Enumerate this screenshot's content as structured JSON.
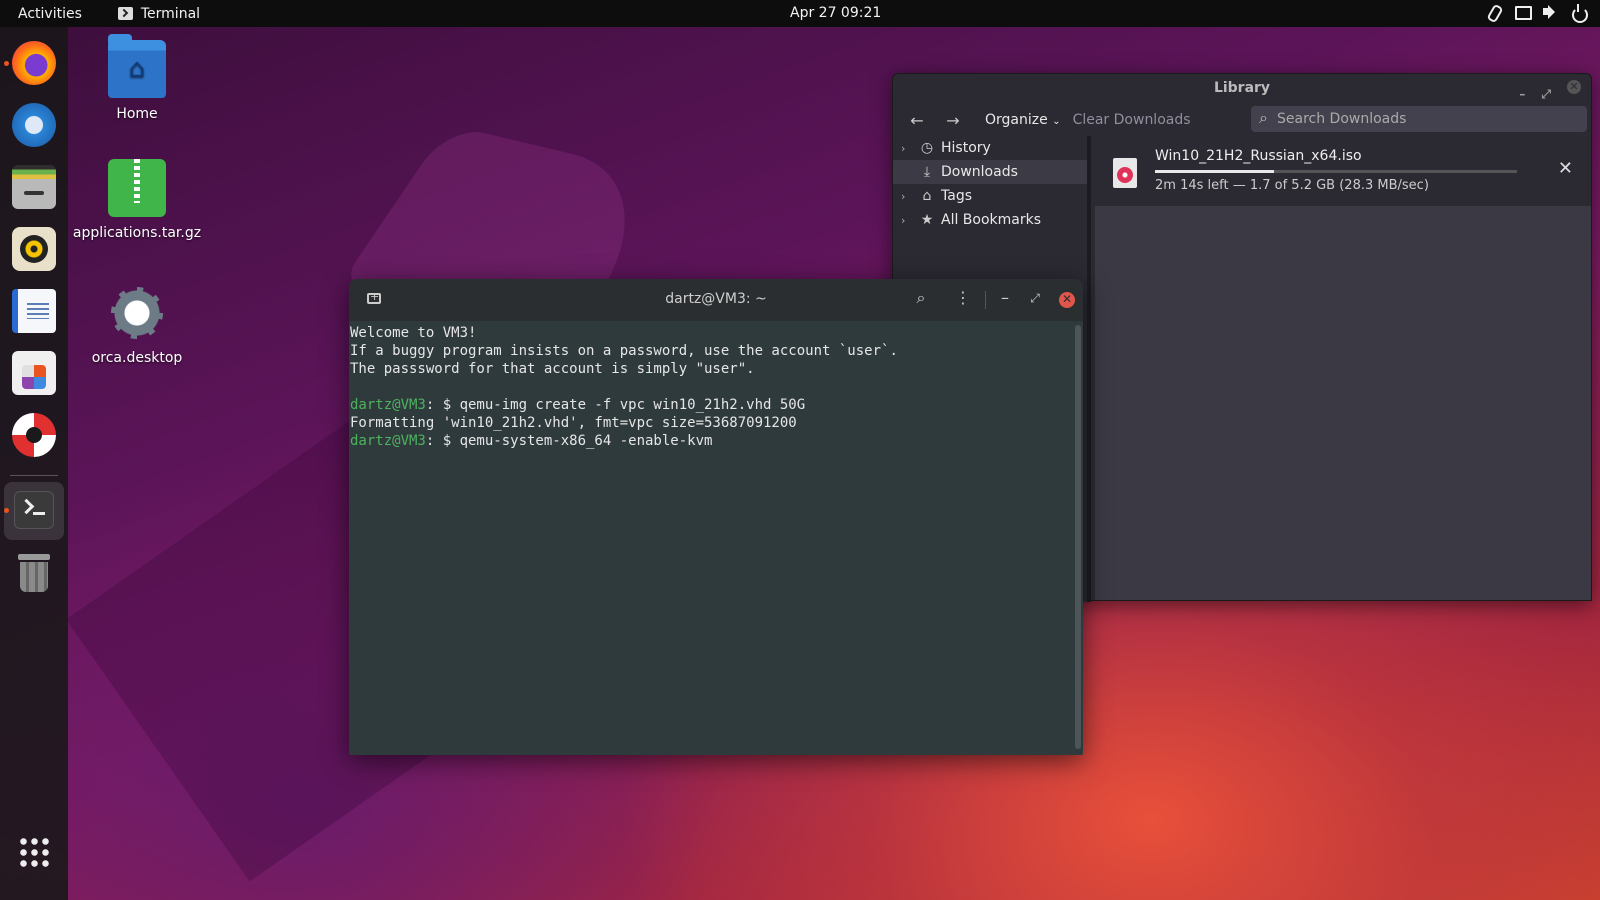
{
  "topbar": {
    "activities": "Activities",
    "app_name": "Terminal",
    "clock": "Apr 27  09:21",
    "tray": [
      "paperclip-icon",
      "display-icon",
      "volume-icon",
      "power-icon"
    ]
  },
  "dock": {
    "items": [
      "firefox",
      "thunderbird",
      "files",
      "rhythmbox",
      "libreoffice-writer",
      "ubuntu-software",
      "help",
      "terminal",
      "trash"
    ],
    "show_apps": "show-applications-icon"
  },
  "desktop": {
    "icons": [
      {
        "label": "Home"
      },
      {
        "label": "applications.tar.gz"
      },
      {
        "label": "orca.desktop"
      }
    ]
  },
  "library": {
    "title": "Library",
    "toolbar": {
      "back": "←",
      "forward": "→",
      "organize": "Organize",
      "clear": "Clear Downloads",
      "search_placeholder": "Search Downloads"
    },
    "sidebar": [
      {
        "label": "History",
        "icon": "clock-icon",
        "expandable": true
      },
      {
        "label": "Downloads",
        "icon": "download-icon",
        "expandable": false,
        "selected": true
      },
      {
        "label": "Tags",
        "icon": "tag-icon",
        "expandable": true
      },
      {
        "label": "All Bookmarks",
        "icon": "star-icon",
        "expandable": true
      }
    ],
    "download": {
      "filename": "Win10_21H2_Russian_x64.iso",
      "status": "2m 14s left — 1.7 of 5.2 GB (28.3 MB/sec)",
      "progress_percent": 33
    }
  },
  "terminal": {
    "title": "dartz@VM3: ~",
    "lines": [
      {
        "text": "Welcome to VM3!"
      },
      {
        "text": "If a buggy program insists on a password, use the account `user`."
      },
      {
        "text": "The passsword for that account is simply \"user\"."
      },
      {
        "text": ""
      },
      {
        "prompt": "dartz@VM3",
        "text": ": $ qemu-img create -f vpc win10_21h2.vhd 50G"
      },
      {
        "text": "Formatting 'win10_21h2.vhd', fmt=vpc size=53687091200"
      },
      {
        "prompt": "dartz@VM3",
        "text": ": $ qemu-system-x86_64 -enable-kvm"
      }
    ]
  },
  "colors": {
    "prompt_green": "#4eb15e",
    "ubuntu_orange": "#e95420",
    "terminal_bg": "#2f3a3d"
  }
}
